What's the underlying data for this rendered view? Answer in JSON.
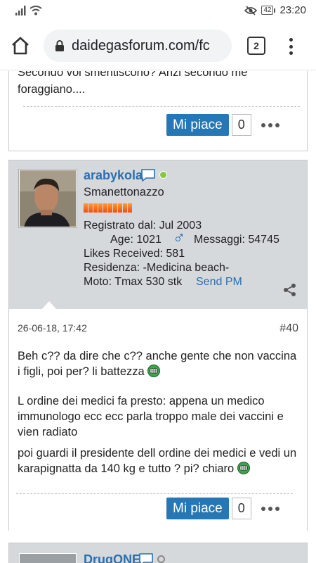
{
  "status_bar": {
    "time": "23:20",
    "battery": "42"
  },
  "browser": {
    "url": "daidegasforum.com/fc",
    "tab_count": "2"
  },
  "post1": {
    "text": "Secondo voi smentiscono? Anzi secondo me foraggiano....",
    "like_label": "Mi piace",
    "like_count": "0"
  },
  "post2": {
    "username": "arabykola",
    "user_title": "Smanettonazzo",
    "registered": "Registrato dal: Jul 2003",
    "age": "Age: 1021",
    "messages": "Messaggi: 54745",
    "likes_received": "Likes Received: 581",
    "residence": "Residenza: -Medicina beach-",
    "moto": "Moto: Tmax 530 stk",
    "send_pm": "Send PM",
    "date": "26-06-18, 17:42",
    "number": "#40",
    "paragraphs": [
      "Beh c?? da dire che c?? anche gente che non vaccina i figli, poi per? li battezza",
      "L ordine dei medici fa presto: appena un medico immunologo ecc ecc parla troppo male dei vaccini e vien radiato",
      "poi guardi il presidente dell ordine dei medici e vedi un karapignatta da 140 kg e tutto ? pi? chiaro"
    ],
    "like_label": "Mi piace",
    "like_count": "0"
  },
  "post3": {
    "username": "DrugONE"
  },
  "colors": {
    "accent": "#2577b5",
    "username": "#2a6fb0",
    "profile_bg": "#d5d9dc",
    "online": "#88c540"
  }
}
